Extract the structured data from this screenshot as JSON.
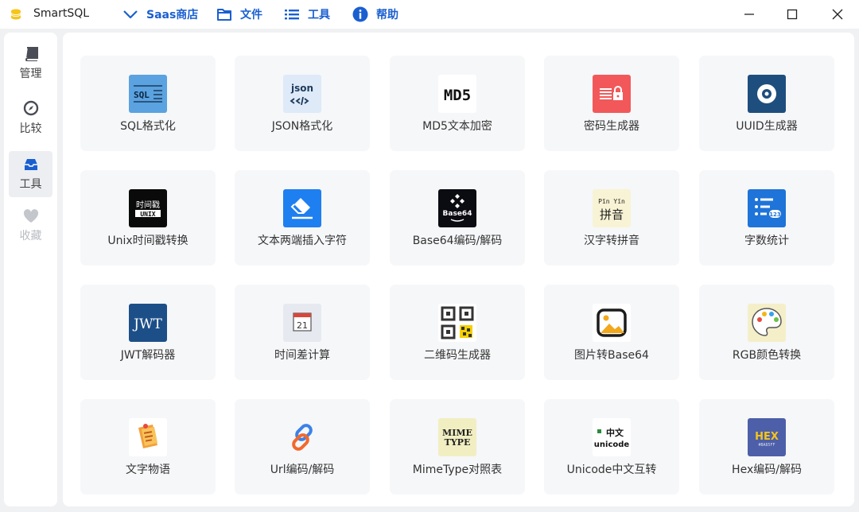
{
  "app": {
    "title": "SmartSQL"
  },
  "menu": [
    {
      "label": "Saas商店",
      "icon": "chevron-down-icon"
    },
    {
      "label": "文件",
      "icon": "folder-icon"
    },
    {
      "label": "工具",
      "icon": "list-icon"
    },
    {
      "label": "帮助",
      "icon": "info-icon"
    }
  ],
  "sidebar": {
    "items": [
      {
        "label": "管理",
        "icon": "book-icon",
        "active": false
      },
      {
        "label": "比较",
        "icon": "compass-icon",
        "active": false
      },
      {
        "label": "工具",
        "icon": "inbox-icon",
        "active": true
      },
      {
        "label": "收藏",
        "icon": "heart-icon",
        "active": false
      }
    ]
  },
  "tools": [
    {
      "label": "SQL格式化",
      "icon_text": "SQL"
    },
    {
      "label": "JSON格式化",
      "icon_text": "json"
    },
    {
      "label": "MD5文本加密",
      "icon_text": "MD5"
    },
    {
      "label": "密码生成器"
    },
    {
      "label": "UUID生成器"
    },
    {
      "label": "Unix时间戳转换",
      "icon_text": [
        "时间戳",
        "UNIX"
      ]
    },
    {
      "label": "文本两端插入字符"
    },
    {
      "label": "Base64编码/解码",
      "icon_text": "Base64"
    },
    {
      "label": "汉字转拼音",
      "icon_text": [
        "Pīn Yīn",
        "拼音"
      ]
    },
    {
      "label": "字数统计",
      "icon_text": "123"
    },
    {
      "label": "JWT解码器",
      "icon_text": "JWT"
    },
    {
      "label": "时间差计算",
      "icon_text": "21"
    },
    {
      "label": "二维码生成器"
    },
    {
      "label": "图片转Base64"
    },
    {
      "label": "RGB颜色转换"
    },
    {
      "label": "文字物语"
    },
    {
      "label": "Url编码/解码"
    },
    {
      "label": "MimeType对照表",
      "icon_text": [
        "MIME",
        "TYPE"
      ]
    },
    {
      "label": "Unicode中文互转",
      "icon_text": [
        "中文",
        "unicode"
      ]
    },
    {
      "label": "Hex编码/解码",
      "icon_text": [
        "HEX",
        "#BA85FF"
      ]
    }
  ]
}
